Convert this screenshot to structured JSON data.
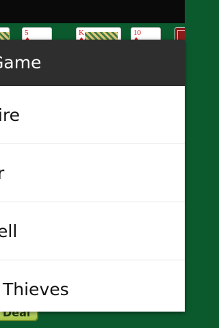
{
  "background": {
    "felt_color": "#0b5a2e",
    "top_bar_color": "#0a0a0a",
    "cards": [
      {
        "rank": "",
        "suit": "",
        "kind": "partial"
      },
      {
        "rank": "5",
        "suit": "♦",
        "kind": "face-up",
        "color": "red"
      },
      {
        "rank": "K",
        "suit": "♦",
        "kind": "face-up-court",
        "color": "red"
      },
      {
        "rank": "10",
        "suit": "♦",
        "kind": "face-up",
        "color": "red"
      },
      {
        "rank": "",
        "suit": "",
        "kind": "partial"
      }
    ],
    "deal_button_label": "Deal"
  },
  "menu": {
    "title": "Game",
    "header_color": "#2e2e2e",
    "items": [
      {
        "label": "ire"
      },
      {
        "label": "r"
      },
      {
        "label": "ell"
      },
      {
        "label": "Thieves"
      }
    ]
  }
}
